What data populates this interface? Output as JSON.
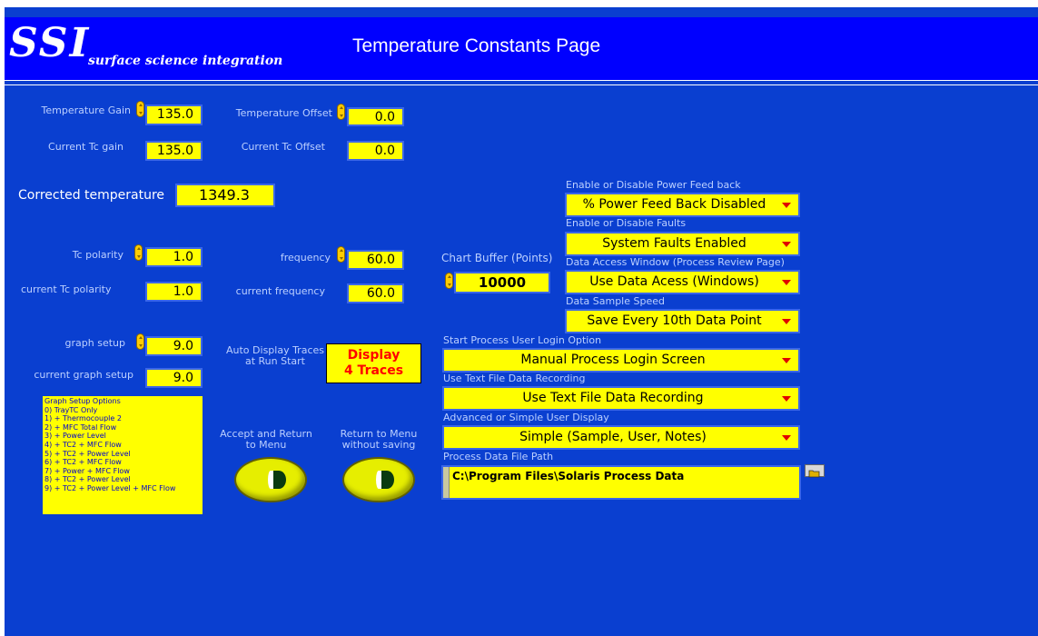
{
  "header": {
    "logo_mark": "SSI",
    "logo_text": "surface science integration",
    "title": "Temperature Constants Page"
  },
  "constants": {
    "temperature_gain": {
      "label": "Temperature Gain",
      "value": "135.0"
    },
    "temperature_offset": {
      "label": "Temperature Offset",
      "value": "0.0"
    },
    "current_tc_gain": {
      "label": "Current Tc gain",
      "value": "135.0"
    },
    "current_tc_offset": {
      "label": "Current Tc Offset",
      "value": "0.0"
    },
    "corrected_temperature": {
      "label": "Corrected temperature",
      "value": "1349.3"
    },
    "tc_polarity": {
      "label": "Tc polarity",
      "value": "1.0"
    },
    "frequency": {
      "label": "frequency",
      "value": "60.0"
    },
    "current_tc_polarity": {
      "label": "current Tc  polarity",
      "value": "1.0"
    },
    "current_frequency": {
      "label": "current frequency",
      "value": "60.0"
    },
    "graph_setup": {
      "label": "graph setup",
      "value": "9.0"
    },
    "current_graph_setup": {
      "label": "current graph setup",
      "value": "9.0"
    }
  },
  "graph_options": {
    "title": "Graph Setup Options",
    "items": [
      "0) TrayTC Only",
      "1) + Thermocouple 2",
      "2) + MFC Total Flow",
      "3) + Power Level",
      "4) + TC2 + MFC Flow",
      "5) + TC2 + Power Level",
      "6) + TC2 + MFC Flow",
      "7) + Power + MFC Flow",
      "8) + TC2 + Power Level",
      "9) + TC2 + Power Level + MFC Flow"
    ]
  },
  "auto_display": {
    "label_line1": "Auto Display Traces",
    "label_line2": "at Run Start",
    "button_line1": "Display",
    "button_line2": "4 Traces"
  },
  "buttons": {
    "accept_line1": "Accept and Return",
    "accept_line2": "to Menu",
    "return_line1": "Return to Menu",
    "return_line2": "without saving"
  },
  "chart_buffer": {
    "label": "Chart Buffer (Points)",
    "value": "10000"
  },
  "settings": {
    "power_feedback": {
      "label": "Enable or Disable Power Feed back",
      "value": "% Power Feed Back Disabled"
    },
    "faults": {
      "label": "Enable or Disable Faults",
      "value": "System Faults Enabled"
    },
    "data_access": {
      "label": "Data Access Window (Process Review Page)",
      "value": "Use Data Acess (Windows)"
    },
    "sample_speed": {
      "label": "Data Sample Speed",
      "value": "Save Every 10th Data Point"
    },
    "login_option": {
      "label": "Start Process User Login Option",
      "value": "Manual Process Login Screen"
    },
    "text_recording": {
      "label": "Use Text File Data Recording",
      "value": "Use Text File Data Recording"
    },
    "user_display": {
      "label": "Advanced or Simple User Display",
      "value": "Simple (Sample, User, Notes)"
    },
    "file_path": {
      "label": "Process Data File Path",
      "value": "C:\\Program Files\\Solaris Process Data"
    }
  },
  "colors": {
    "background": "#0a3fd0",
    "banner": "#0000ff",
    "field": "#ffff00",
    "label": "#bcd0ff",
    "alert_text": "#ff0000"
  }
}
